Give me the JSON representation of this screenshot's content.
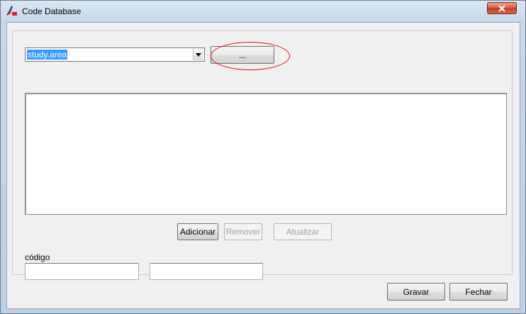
{
  "window": {
    "title": "Code Database",
    "app_icon": "drawing-app-icon",
    "close_icon": "close-x-icon"
  },
  "study_area": {
    "selected": "study.area",
    "dropdown_icon": "chevron-down-icon",
    "browse_label": "..."
  },
  "list": {
    "items": []
  },
  "actions": {
    "add_label": "Adicionar",
    "remove_label": "Remover",
    "update_label": "Atualizar"
  },
  "code": {
    "label": "código",
    "code_value": "",
    "description_value": ""
  },
  "footer": {
    "save_label": "Gravar",
    "close_label": "Fechar"
  },
  "colors": {
    "highlight_ring": "#dd1111",
    "selection": "#3399ff",
    "close_button": "#c23a1e"
  }
}
